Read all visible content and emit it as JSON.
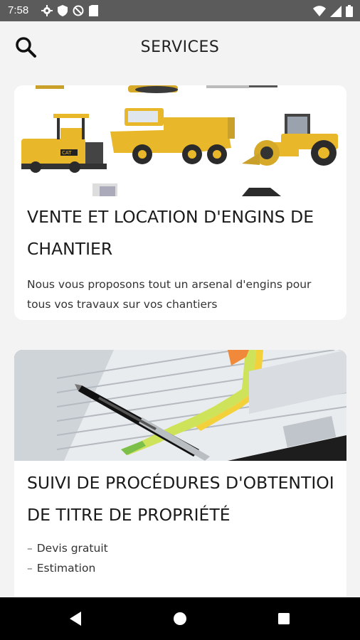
{
  "status_bar": {
    "time": "7:58",
    "left_icons": [
      "gear-icon",
      "shield-icon",
      "no-disturb-icon",
      "sim-card-icon"
    ],
    "right_icons": [
      "wifi-icon",
      "signal-icon",
      "battery-icon"
    ]
  },
  "app_bar": {
    "title": "SERVICES",
    "search_icon": "search-icon"
  },
  "cards": [
    {
      "title": "VENTE ET LOCATION D'ENGINS DE CHANTIER",
      "description": "Nous vous proposons tout un arsenal d'engins pour tous vos travaux sur vos chantiers",
      "image": "construction-machinery-image"
    },
    {
      "title_line1": "SUIVI DE PROCÉDURES D'OBTENTIOI",
      "title_line2": "DE TITRE DE PROPRIÉTÉ",
      "items": [
        "Devis gratuit",
        "Estimation"
      ],
      "image": "document-with-pen-image"
    }
  ],
  "nav_bar": {
    "buttons": [
      "back-icon",
      "home-icon",
      "recents-icon"
    ]
  },
  "colors": {
    "status_bar": "#5b5b5b",
    "background": "#f3f3f3",
    "card": "#ffffff",
    "nav_bar": "#000000",
    "machine_yellow": "#e8b82a"
  }
}
